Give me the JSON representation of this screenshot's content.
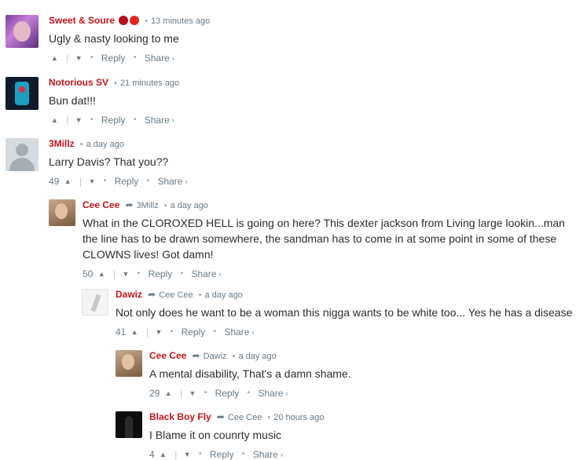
{
  "labels": {
    "reply": "Reply",
    "share": "Share"
  },
  "comments": [
    {
      "author": "Sweet & Soure",
      "time": "13 minutes ago",
      "text": "Ugly & nasty looking to me",
      "votes": "",
      "badges": [
        "lips-emoji",
        "angry-emoji"
      ]
    },
    {
      "author": "Notorious SV",
      "time": "21 minutes ago",
      "text": "Bun dat!!!",
      "votes": ""
    },
    {
      "author": "3Millz",
      "time": "a day ago",
      "text": "Larry Davis? That you??",
      "votes": "49"
    },
    {
      "author": "Cee Cee",
      "reply_to": "3Millz",
      "time": "a day ago",
      "text": "What in the CLOROXED HELL is going on here? This dexter jackson from Living large lookin...man the line has to be drawn somewhere, the sandman has to come in at some point in some of these CLOWNS lives! Got damn!",
      "votes": "50"
    },
    {
      "author": "Dawiz",
      "reply_to": "Cee Cee",
      "time": "a day ago",
      "text": "Not only does he want to be a woman this nigga wants to be white too... Yes he has a disease",
      "votes": "41"
    },
    {
      "author": "Cee Cee",
      "reply_to": "Dawiz",
      "time": "a day ago",
      "text": "A mental disability, That's a damn shame.",
      "votes": "29"
    },
    {
      "author": "Black Boy Fly",
      "reply_to": "Cee Cee",
      "time": "20 hours ago",
      "text": "I Blame it on counrty music",
      "votes": "4"
    }
  ]
}
